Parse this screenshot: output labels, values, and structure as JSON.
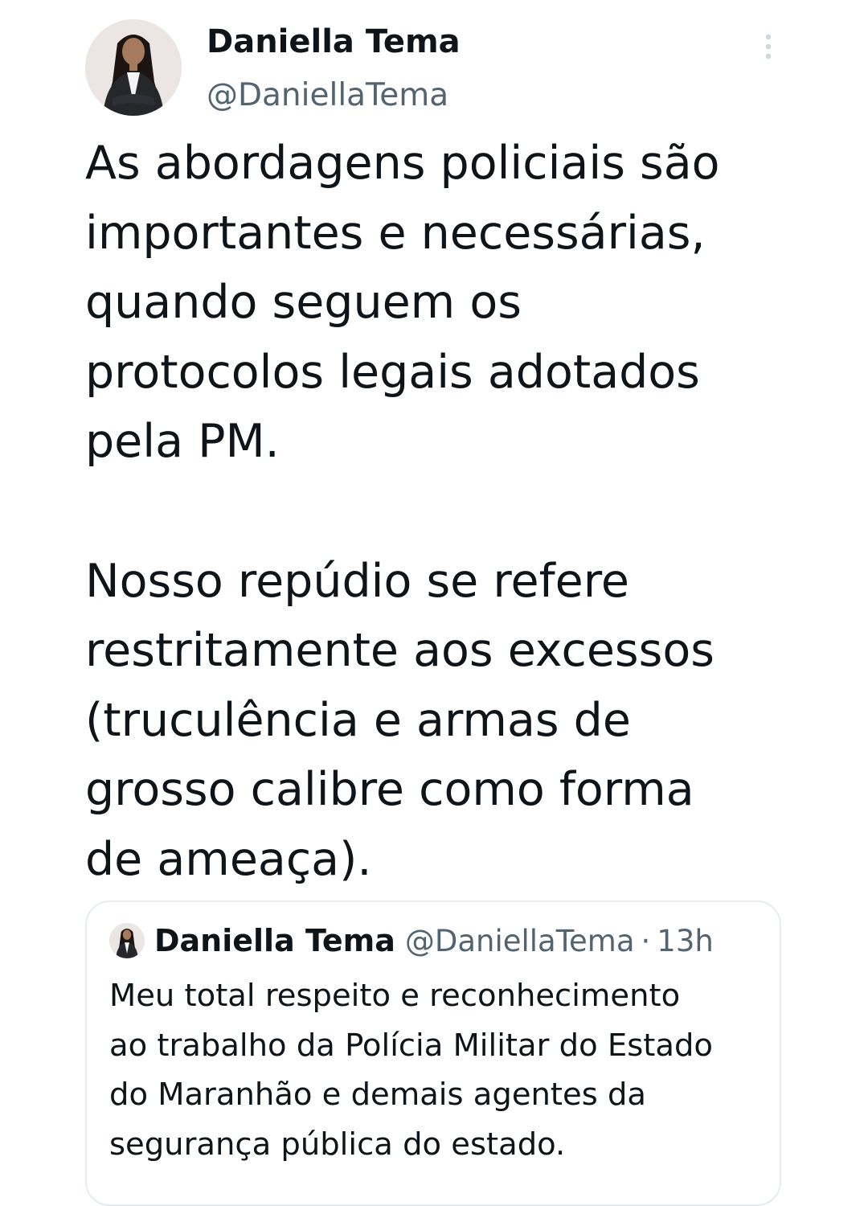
{
  "tweet": {
    "author": {
      "display_name": "Daniella Tema",
      "handle": "@DaniellaTema",
      "avatar_icon": "profile-photo"
    },
    "more_icon": "vertical-ellipsis-icon",
    "body_paragraph_1": [
      "As abordagens policiais são",
      "importantes e necessárias,",
      "quando seguem os",
      "protocolos legais adotados",
      "pela PM."
    ],
    "body_paragraph_2": [
      "Nosso repúdio se refere",
      "restritamente aos excessos",
      "(truculência e armas de",
      "grosso calibre como forma",
      "de ameaça)."
    ]
  },
  "quoted_tweet": {
    "display_name": "Daniella Tema",
    "handle": "@DaniellaTema",
    "separator": "·",
    "time": "13h",
    "text_lines": [
      "Meu total respeito e reconhecimento",
      "ao trabalho da Polícia Militar do Estado",
      "do Maranhão e demais agentes da",
      "segurança pública do estado."
    ]
  },
  "colors": {
    "text_primary": "#0f1419",
    "text_secondary": "#536471",
    "border": "#e6ecf0"
  }
}
